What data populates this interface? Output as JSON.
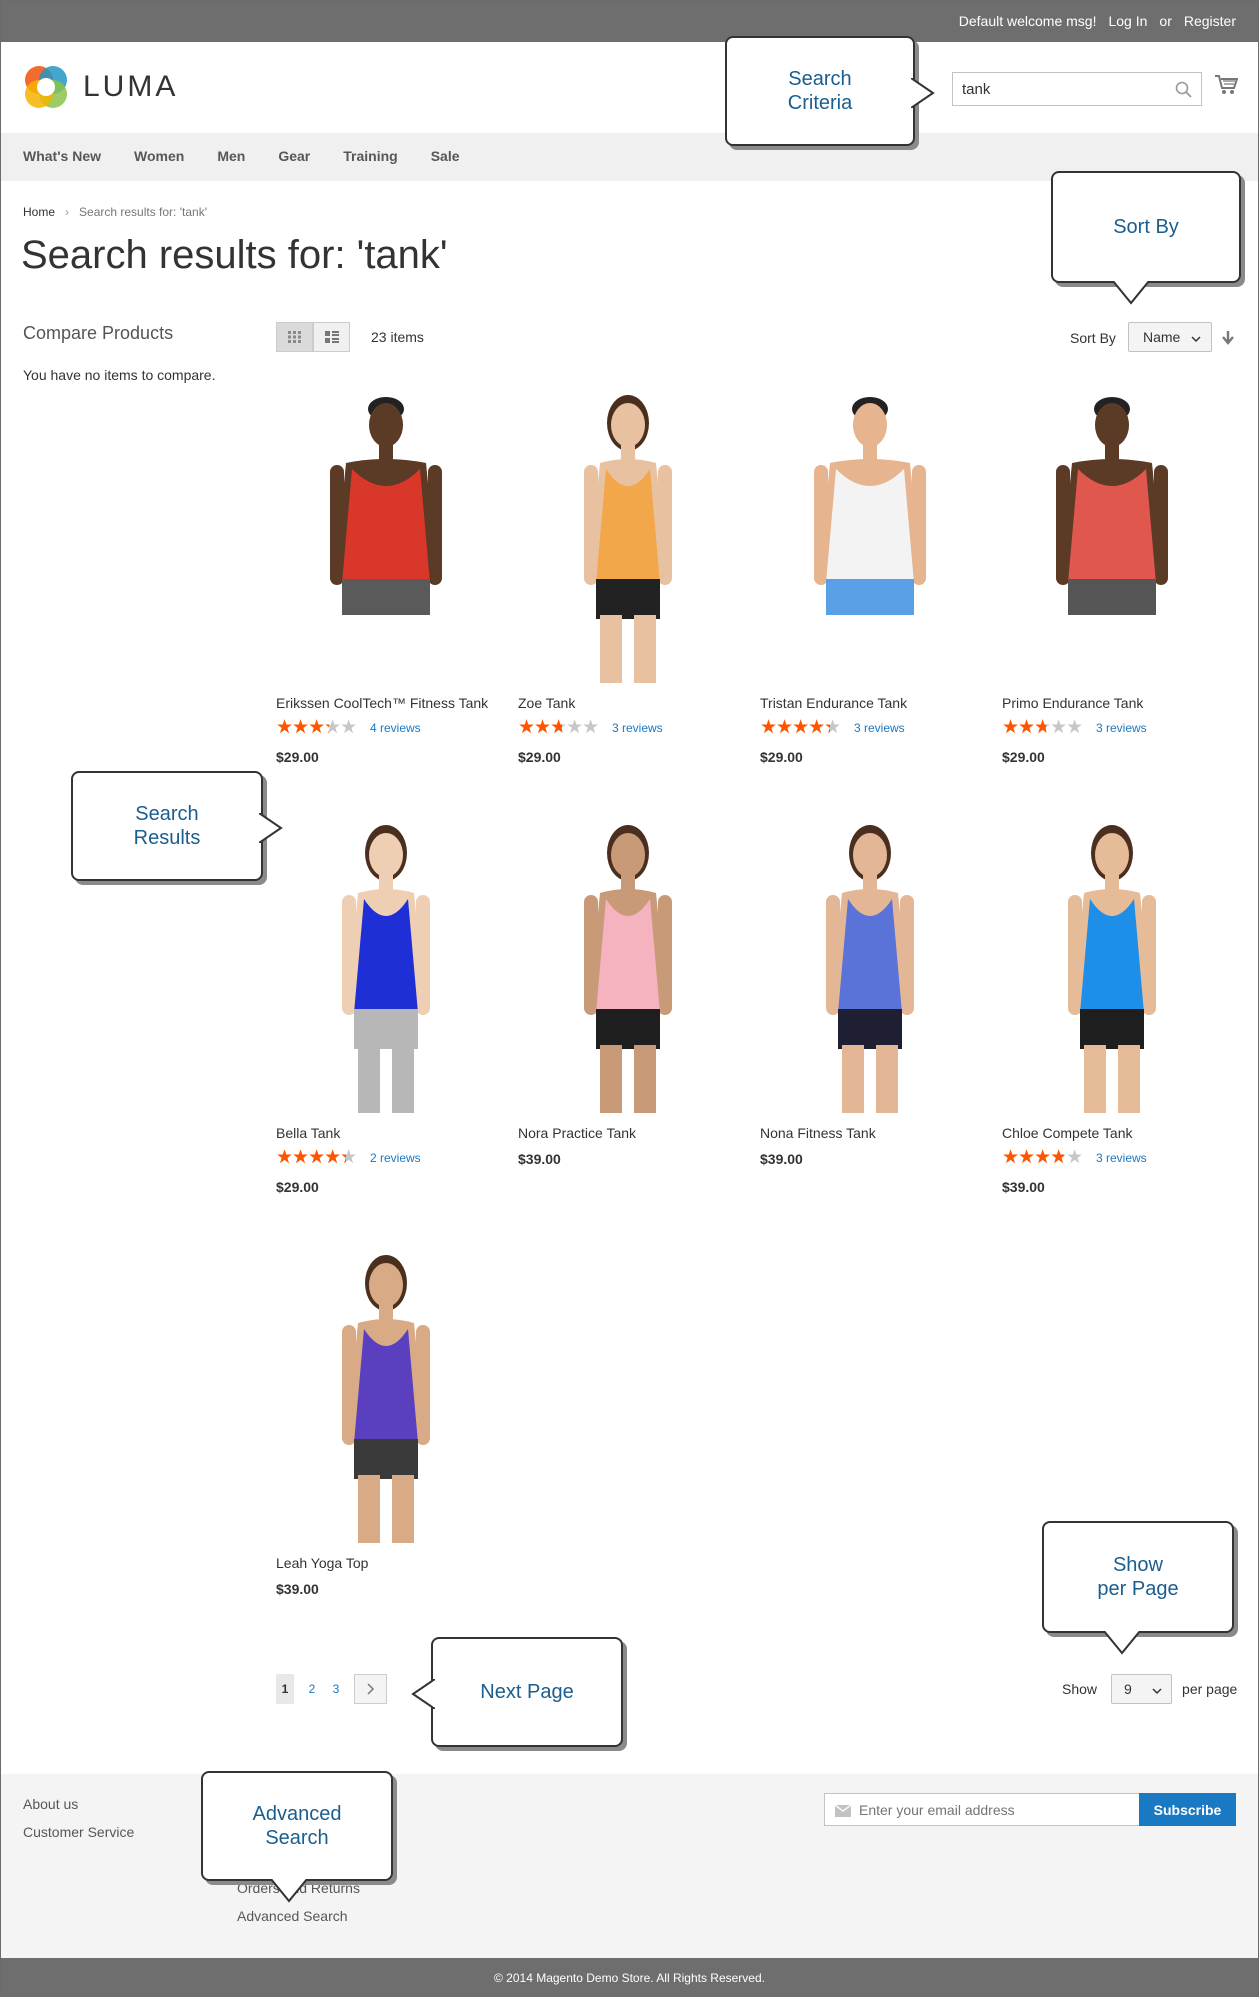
{
  "top_panel": {
    "welcome": "Default welcome msg!",
    "login": "Log In",
    "or": "or",
    "register": "Register"
  },
  "header": {
    "logo_text": "LUMA",
    "search_value": "tank"
  },
  "nav": {
    "items": [
      "What's New",
      "Women",
      "Men",
      "Gear",
      "Training",
      "Sale"
    ]
  },
  "breadcrumb": {
    "home": "Home",
    "current": "Search results for: 'tank'"
  },
  "page_title": "Search results for: 'tank'",
  "sidebar": {
    "compare_title": "Compare Products",
    "compare_empty": "You have no items to compare."
  },
  "toolbar": {
    "amount": "23 items",
    "sort_label": "Sort By",
    "sort_value": "Name",
    "show_label": "Show",
    "show_value": "9",
    "per_page": "per page"
  },
  "products": [
    {
      "name": "Erikssen CoolTech™ Fitness Tank",
      "rating_pct": 60,
      "reviews": "4 reviews",
      "price": "$29.00",
      "shirt": "#d9372a",
      "bottom": "#5a5a5a",
      "skin": "#5b3a26",
      "female": false
    },
    {
      "name": "Zoe Tank",
      "rating_pct": 50,
      "reviews": "3 reviews",
      "price": "$29.00",
      "shirt": "#f2a84a",
      "bottom": "#222",
      "skin": "#e8c2a0",
      "female": true
    },
    {
      "name": "Tristan Endurance Tank",
      "rating_pct": 80,
      "reviews": "3 reviews",
      "price": "$29.00",
      "shirt": "#f3f3f3",
      "bottom": "#5aa0e6",
      "skin": "#e6b48e",
      "female": false
    },
    {
      "name": "Primo Endurance Tank",
      "rating_pct": 50,
      "reviews": "3 reviews",
      "price": "$29.00",
      "shirt": "#e0584d",
      "bottom": "#555",
      "skin": "#5b3a26",
      "female": false
    },
    {
      "name": "Bella Tank",
      "rating_pct": 80,
      "reviews": "2 reviews",
      "price": "$29.00",
      "shirt": "#1f2fd6",
      "bottom": "#b7b7b7",
      "skin": "#efcfb3",
      "female": true
    },
    {
      "name": "Nora Practice Tank",
      "rating_pct": 0,
      "reviews": "",
      "price": "$39.00",
      "shirt": "#f5b3c0",
      "bottom": "#1e1e1e",
      "skin": "#c99a78",
      "female": true
    },
    {
      "name": "Nona Fitness Tank",
      "rating_pct": 0,
      "reviews": "",
      "price": "$39.00",
      "shirt": "#5a73d8",
      "bottom": "#1f1f33",
      "skin": "#e3b696",
      "female": true
    },
    {
      "name": "Chloe Compete Tank",
      "rating_pct": 70,
      "reviews": "3 reviews",
      "price": "$39.00",
      "shirt": "#1e8fe8",
      "bottom": "#1e1e1e",
      "skin": "#e5bb98",
      "female": true
    },
    {
      "name": "Leah Yoga Top",
      "rating_pct": 0,
      "reviews": "",
      "price": "$39.00",
      "shirt": "#5a3fbf",
      "bottom": "#3a3a3a",
      "skin": "#d8aa86",
      "female": true
    }
  ],
  "pagination": {
    "pages": [
      "1",
      "2",
      "3"
    ],
    "current": "1"
  },
  "footer": {
    "links": [
      "About us",
      "Customer Service",
      "Orders and Returns",
      "Advanced Search"
    ],
    "newsletter_placeholder": "Enter your email address",
    "subscribe": "Subscribe",
    "copyright": "© 2014 Magento Demo Store. All Rights Reserved."
  },
  "callouts": {
    "search_criteria": "Search\nCriteria",
    "sort_by": "Sort By",
    "search_results": "Search\nResults",
    "show_per_page": "Show\nper Page",
    "next_page": "Next Page",
    "advanced_search": "Advanced\nSearch"
  },
  "colors": {
    "accent": "#1979c3",
    "star": "#ff5501",
    "callout_text": "#1a5e8f"
  }
}
